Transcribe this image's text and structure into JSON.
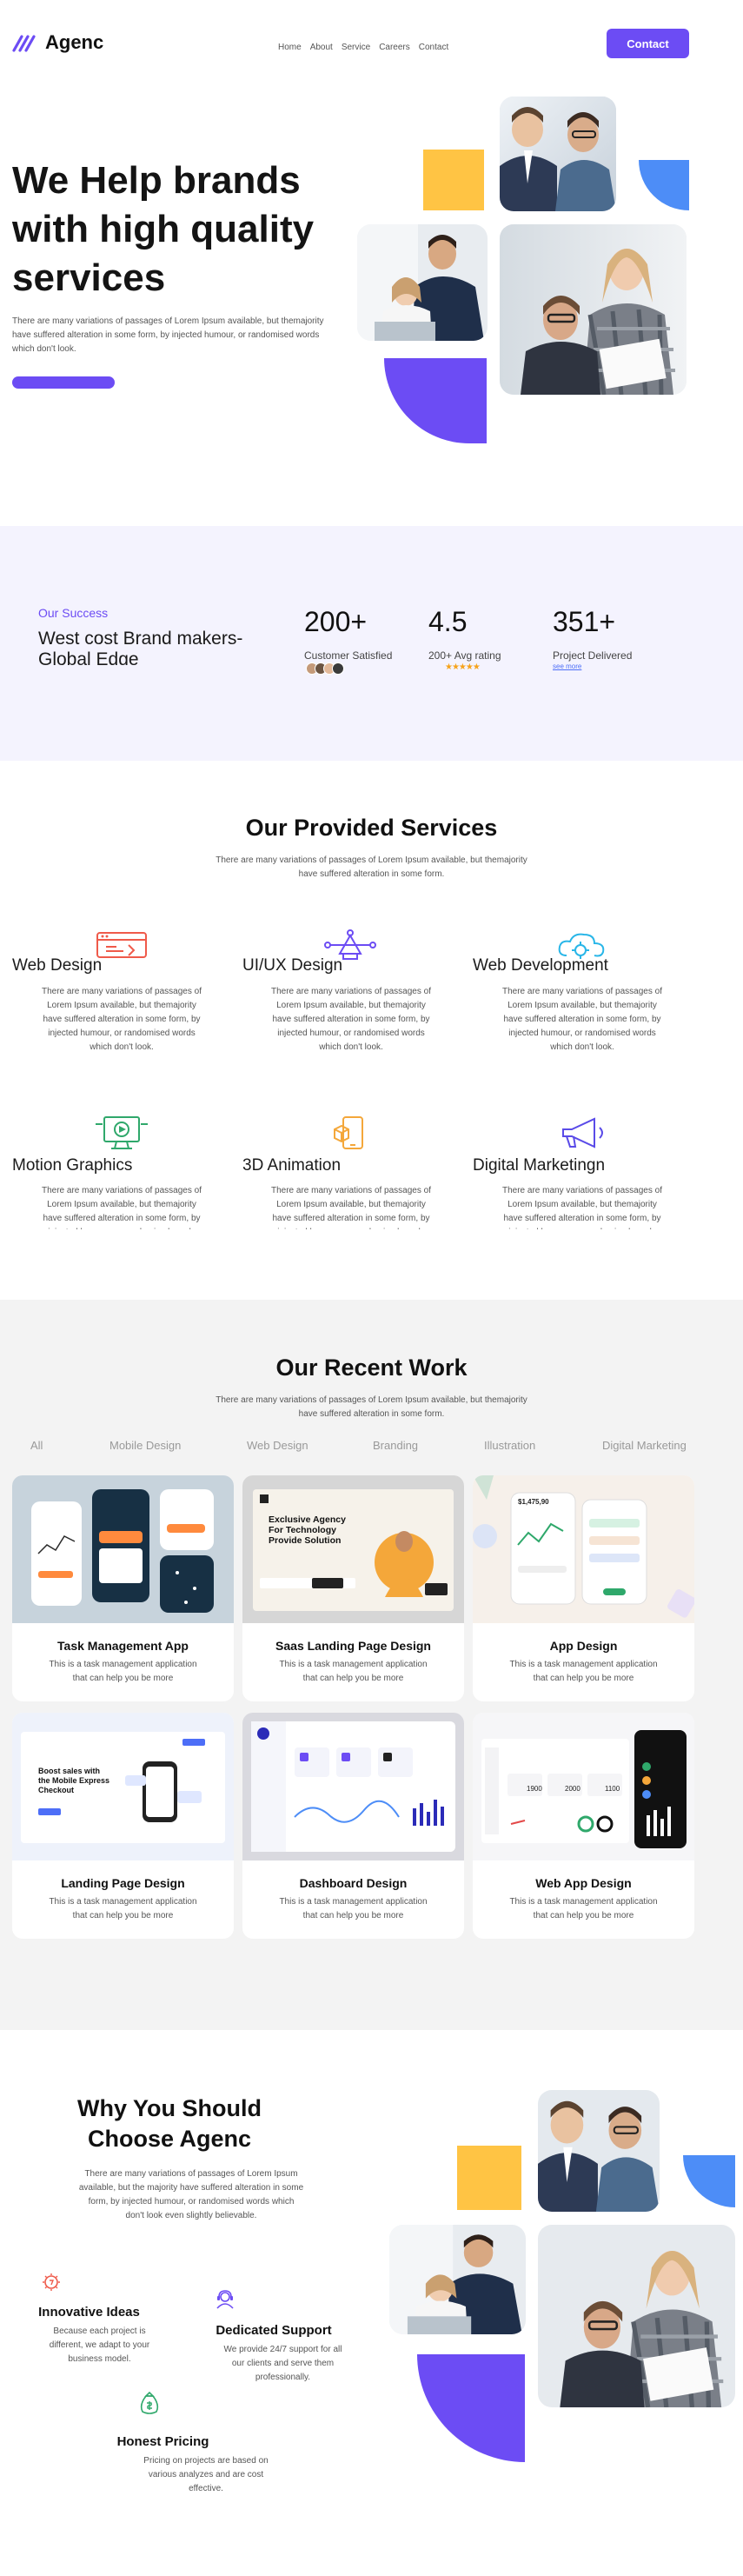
{
  "brand": {
    "name": "Agenc",
    "accent": "#6c4cf4",
    "yellow": "#ffc444",
    "blue": "#4d8df7"
  },
  "nav": {
    "items": [
      "Home",
      "About",
      "Service",
      "Careers",
      "Contact"
    ],
    "cta": "Contact"
  },
  "hero": {
    "title_lines": [
      "We Help brands",
      "with high quality",
      "services"
    ],
    "description": "There are many variations of passages of Lorem Ipsum available, but themajority have suffered alteration in some form, by injected humour, or randomised words which don't look."
  },
  "stats": {
    "eyebrow": "Our Success",
    "heading": "West cost Brand makers-Global Edge",
    "items": [
      {
        "value": "200+",
        "label": "Customer Satisfied"
      },
      {
        "value": "4.5",
        "label": "200+ Avg rating"
      },
      {
        "value": "351+",
        "label": "Project Delivered",
        "link": "see more"
      }
    ]
  },
  "services": {
    "title": "Our Provided Services",
    "subtitle_lines": [
      "There are many variations of passages of Lorem Ipsum available, but themajority",
      "have suffered alteration in some form."
    ],
    "description_lines": [
      "There are many variations of passages of",
      "Lorem Ipsum available, but themajority",
      "have suffered alteration in some form, by",
      "injected humour, or randomised words",
      "which don't look."
    ],
    "items": [
      {
        "title": "Web Design",
        "icon": "browser-icon"
      },
      {
        "title": "UI/UX Design",
        "icon": "pen-tool-icon"
      },
      {
        "title": "Web Development",
        "icon": "cloud-gear-icon"
      },
      {
        "title": "Motion Graphics",
        "icon": "monitor-icon"
      },
      {
        "title": "3D Animation",
        "icon": "phone-cube-icon"
      },
      {
        "title": "Digital Marketingn",
        "icon": "megaphone-icon"
      }
    ]
  },
  "work": {
    "title": "Our Recent Work",
    "subtitle_lines": [
      "There are many variations of passages of Lorem Ipsum available, but themajority",
      "have suffered alteration in some form."
    ],
    "filters": [
      "All",
      "Mobile Design",
      "Web Design",
      "Branding",
      "Illustration",
      "Digital Marketing"
    ],
    "card_description": "This is a task management application that can help you be more",
    "cards": [
      {
        "title": "Task Management App"
      },
      {
        "title": "Saas Landing Page Design",
        "mock_headline": [
          "Exclusive Agency",
          "For Technology",
          "Provide Solution"
        ]
      },
      {
        "title": "App Design",
        "mock_value": "$1,475,90"
      },
      {
        "title": "Landing Page Design",
        "mock_headline": [
          "Boost sales with",
          "the Mobile Express",
          "Checkout"
        ]
      },
      {
        "title": "Dashboard Design"
      },
      {
        "title": "Web App Design",
        "mock_values": [
          "1900",
          "2000",
          "1100"
        ]
      }
    ]
  },
  "why": {
    "title_lines": [
      "Why You Should",
      "Choose Agenc"
    ],
    "description": "There are many variations of passages of Lorem Ipsum available, but the majority have suffered alteration in some form, by injected humour, or randomised words which don't look even slightly believable.",
    "features": [
      {
        "title": "Innovative Ideas",
        "description": "Because each project is different, we adapt to your business model."
      },
      {
        "title": "Dedicated Support",
        "description": "We provide 24/7 support for all our clients and serve them professionally."
      },
      {
        "title": "Honest Pricing",
        "description": "Pricing on projects are based on various analyzes and are cost effective."
      }
    ]
  }
}
